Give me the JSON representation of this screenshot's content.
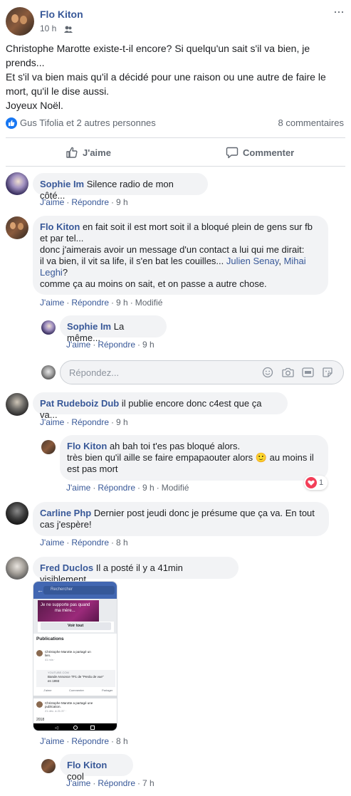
{
  "post": {
    "author": "Flo Kiton",
    "time": "10 h",
    "more": "···",
    "text_lines": [
      "Christophe Marotte existe-t-il encore? Si quelqu'un sait s'il va bien, je",
      "prends...",
      "Et s'il va bien mais qu'il a décidé pour une raison ou une autre de faire le",
      "mort, qu'il le dise aussi.",
      "Joyeux Noël."
    ],
    "reactions_text": "Gus Tifolia et 2 autres personnes",
    "comments_count": "8 commentaires",
    "like_label": "J'aime",
    "comment_label": "Commenter"
  },
  "actions": {
    "like": "J'aime",
    "reply": "Répondre",
    "edited": "Modifié"
  },
  "comments": [
    {
      "author": "Sophie Im",
      "text": "Silence radio de mon côté...",
      "time": "9 h"
    },
    {
      "author": "Flo Kiton",
      "line1": "en fait soit il est mort soit il a bloqué plein de gens sur fb",
      "line2": "et par tel...",
      "line3": "donc j'aimerais avoir un message d'un contact a lui qui me dirait:",
      "line4_pre": "il va bien, il vit sa life, il s'en bat les couilles... ",
      "mention1": "Julien Senay",
      "sep": ", ",
      "mention2_a": "Mihai",
      "mention2_b": "Leghi",
      "line5_post": "?",
      "line6": "comme ça au moins on sait, et on passe a autre chose.",
      "time": "9 h"
    },
    {
      "author": "Sophie Im",
      "text": "La même...",
      "time": "9 h"
    },
    {
      "author": "Pat Rudeboiz Dub",
      "text": "il publie encore donc c4est que ça va...",
      "time": "9 h"
    },
    {
      "author": "Flo Kiton",
      "line1": "ah bah toi t'es pas bloqué alors.",
      "line2": "très bien qu'il aille se faire empapaouter alors",
      "emoji": "🙂",
      "line2_post": " au moins il",
      "line3": "est pas mort",
      "time": "9 h",
      "reaction_count": "1"
    },
    {
      "author": "Carline Php",
      "line1": "Dernier post jeudi donc je présume que ça va. En tout",
      "line2": "cas j'espère!",
      "time": "8 h"
    },
    {
      "author": "Fred Duclos",
      "text": "Il a posté il y a 41min visiblement",
      "time": "8 h"
    },
    {
      "author": "Flo Kiton",
      "text": "cool",
      "time": "7 h"
    }
  ],
  "reply_box": {
    "placeholder": "Répondez..."
  },
  "screenshot": {
    "search": "Rechercher",
    "banner_line1": "Je ne supporte pas quand",
    "banner_line2": "ma mère...",
    "voir_tout": "Voir tout",
    "publications": "Publications",
    "post1_author": "Christophe Marotte a partagé un",
    "post1_author2": "lien.",
    "post1_time": "41 min ·",
    "link_site": "YOUTUBE.COM",
    "link_title1": "Bande Annonce TF1 de \"Perdu de vue\"",
    "link_title2": "en 1993",
    "btn_like": "J'aime",
    "btn_comment": "Commenter",
    "btn_share": "Partager",
    "post2_author": "Christophe Marotte a partagé une",
    "post2_author2": "publication.",
    "post2_time": "21 déc. à 21:37 ·",
    "year": "2018"
  }
}
